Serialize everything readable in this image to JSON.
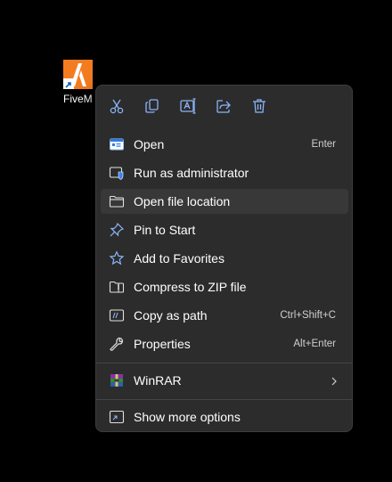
{
  "desktop": {
    "icon_label": "FiveM",
    "accent": "#f47c20"
  },
  "menu": {
    "toolbar": [
      {
        "name": "cut",
        "icon": "scissors-icon"
      },
      {
        "name": "copy",
        "icon": "copy-icon"
      },
      {
        "name": "rename",
        "icon": "rename-icon"
      },
      {
        "name": "share",
        "icon": "share-icon"
      },
      {
        "name": "delete",
        "icon": "trash-icon"
      }
    ],
    "items": [
      {
        "label": "Open",
        "shortcut": "Enter",
        "icon": "app-window-icon"
      },
      {
        "label": "Run as administrator",
        "shortcut": "",
        "icon": "shield-window-icon"
      },
      {
        "label": "Open file location",
        "shortcut": "",
        "icon": "folder-icon"
      },
      {
        "label": "Pin to Start",
        "shortcut": "",
        "icon": "pin-icon"
      },
      {
        "label": "Add to Favorites",
        "shortcut": "",
        "icon": "star-icon"
      },
      {
        "label": "Compress to ZIP file",
        "shortcut": "",
        "icon": "zip-folder-icon"
      },
      {
        "label": "Copy as path",
        "shortcut": "Ctrl+Shift+C",
        "icon": "path-icon"
      },
      {
        "label": "Properties",
        "shortcut": "Alt+Enter",
        "icon": "wrench-icon"
      },
      {
        "label": "WinRAR",
        "shortcut": "",
        "icon": "winrar-icon"
      },
      {
        "label": "Show more options",
        "shortcut": "",
        "icon": "more-options-icon"
      }
    ]
  }
}
